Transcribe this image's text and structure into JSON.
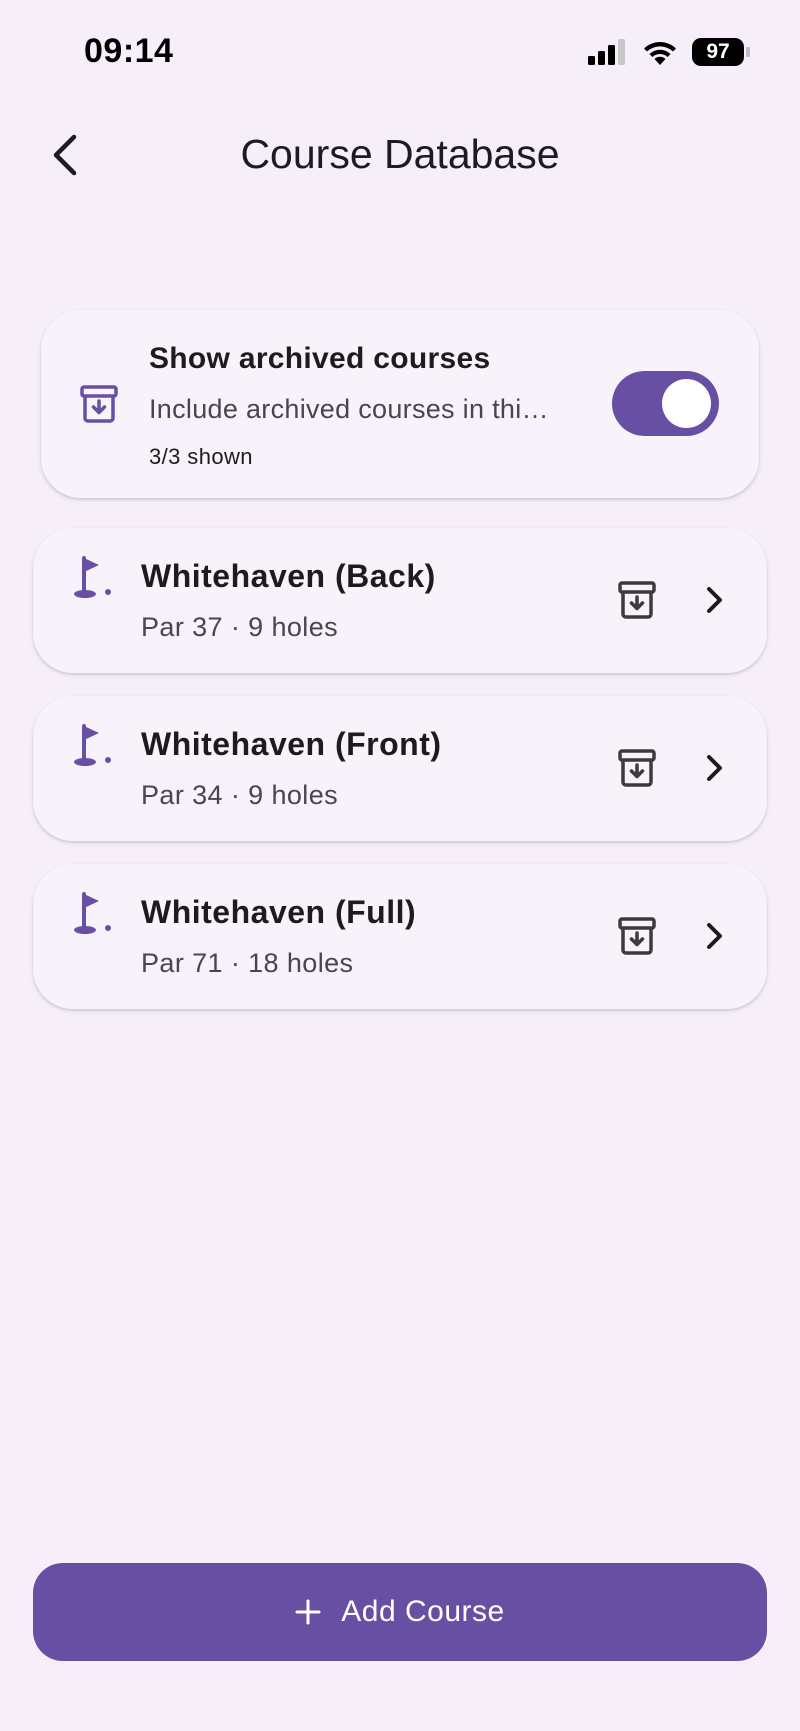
{
  "status_bar": {
    "time": "09:14",
    "battery": "97"
  },
  "app_bar": {
    "title": "Course Database"
  },
  "archive_toggle": {
    "title": "Show archived courses",
    "subtitle": "Include archived courses in thi…",
    "count": "3/3 shown",
    "enabled": true
  },
  "courses": [
    {
      "name": "Whitehaven (Back)",
      "meta": "Par 37 · 9 holes"
    },
    {
      "name": "Whitehaven (Front)",
      "meta": "Par 34 · 9 holes"
    },
    {
      "name": "Whitehaven (Full)",
      "meta": "Par 71 · 18 holes"
    }
  ],
  "add_button": {
    "label": "Add Course"
  },
  "colors": {
    "accent": "#6750a4",
    "background": "#f6eef9",
    "card": "#f8f3fa"
  },
  "icons": {
    "back": "back-arrow-icon",
    "archive": "archive-icon",
    "flag": "golf-flag-icon",
    "chevron": "chevron-right-icon",
    "add": "plus-icon"
  }
}
